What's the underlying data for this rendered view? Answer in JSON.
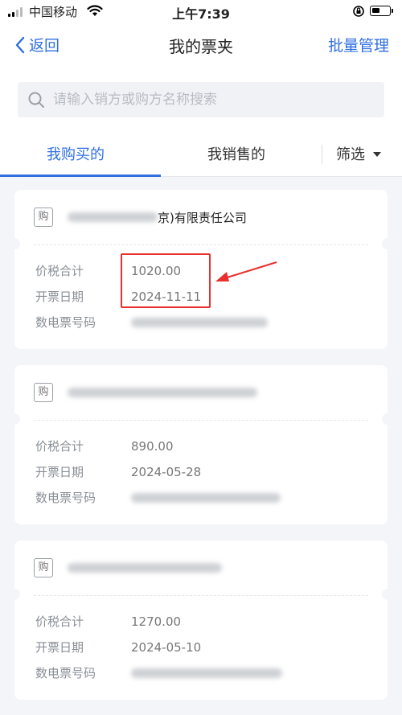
{
  "status_bar": {
    "carrier": "中国移动",
    "time": "上午7:39"
  },
  "nav": {
    "back": "返回",
    "title": "我的票夹",
    "action": "批量管理"
  },
  "search": {
    "placeholder": "请输入销方或购方名称搜索"
  },
  "tabs": {
    "buy": "我购买的",
    "sell": "我销售的",
    "filter": "筛选"
  },
  "labels": {
    "total": "价税合计",
    "date": "开票日期",
    "number": "数电票号码",
    "gou": "购"
  },
  "invoices": [
    {
      "company_suffix": "京)有限责任公司",
      "total": "1020.00",
      "date": "2024-11-11"
    },
    {
      "company_suffix": "",
      "total": "890.00",
      "date": "2024-05-28"
    },
    {
      "company_suffix": "",
      "total": "1270.00",
      "date": "2024-05-10"
    }
  ],
  "colors": {
    "accent": "#2f6fe0",
    "highlight": "#e8302e"
  }
}
